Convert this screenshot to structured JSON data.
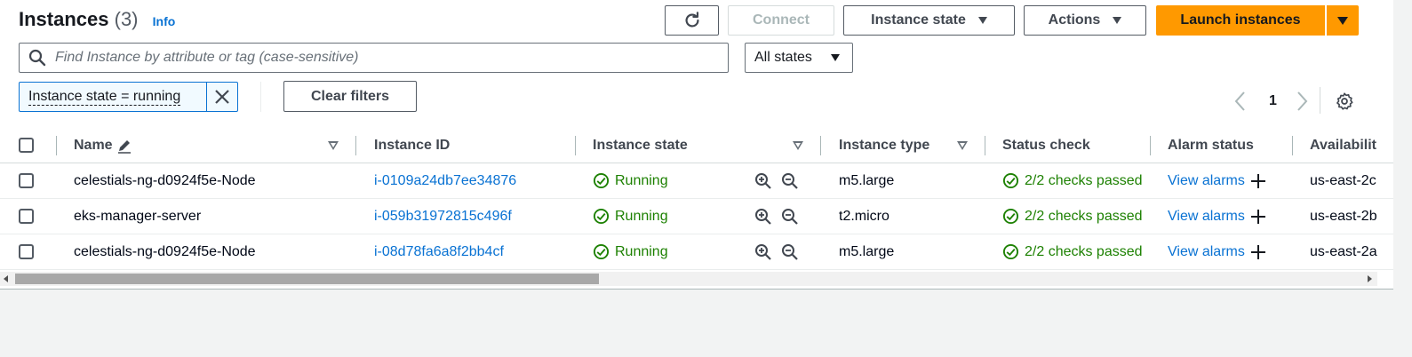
{
  "header": {
    "title": "Instances",
    "count": "(3)",
    "info_link": "Info"
  },
  "toolbar": {
    "refresh_icon": "refresh-icon",
    "connect_label": "Connect",
    "instance_state_label": "Instance state",
    "actions_label": "Actions",
    "launch_label": "Launch instances"
  },
  "search": {
    "placeholder": "Find Instance by attribute or tag (case-sensitive)",
    "value": ""
  },
  "state_filter": {
    "selected": "All states"
  },
  "filter_token": {
    "label": "Instance state = running"
  },
  "clear_filters_label": "Clear filters",
  "pagination": {
    "current_page": "1"
  },
  "colors": {
    "accent": "#0972d3",
    "primary_button": "#ff9900",
    "success": "#1d8102"
  },
  "table": {
    "columns": {
      "name": "Name",
      "instance_id": "Instance ID",
      "instance_state": "Instance state",
      "instance_type": "Instance type",
      "status_check": "Status check",
      "alarm_status": "Alarm status",
      "availability_zone": "Availabilit"
    },
    "rows": [
      {
        "name": "celestials-ng-d0924f5e-Node",
        "instance_id": "i-0109a24db7ee34876",
        "state": "Running",
        "type": "m5.large",
        "status_check": "2/2 checks passed",
        "alarm": "View alarms",
        "az": "us-east-2c"
      },
      {
        "name": "eks-manager-server",
        "instance_id": "i-059b31972815c496f",
        "state": "Running",
        "type": "t2.micro",
        "status_check": "2/2 checks passed",
        "alarm": "View alarms",
        "az": "us-east-2b"
      },
      {
        "name": "celestials-ng-d0924f5e-Node",
        "instance_id": "i-08d78fa6a8f2bb4cf",
        "state": "Running",
        "type": "m5.large",
        "status_check": "2/2 checks passed",
        "alarm": "View alarms",
        "az": "us-east-2a"
      }
    ]
  }
}
